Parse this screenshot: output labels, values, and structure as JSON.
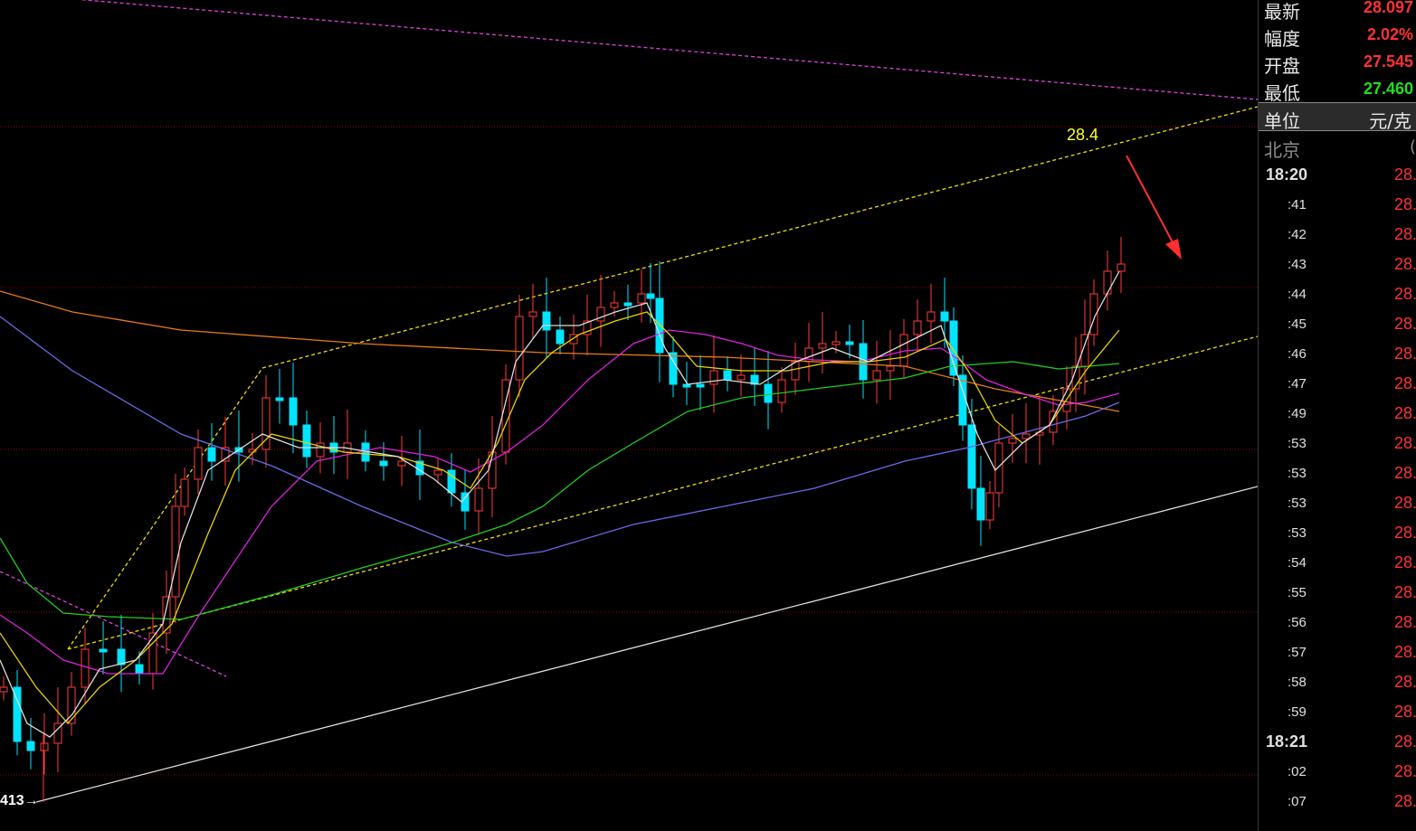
{
  "quote": {
    "rows": [
      {
        "label": "最新",
        "value": "28.097",
        "color": "#ff3333"
      },
      {
        "label": "幅度",
        "value": "2.02%",
        "color": "#ff3333"
      },
      {
        "label": "开盘",
        "value": "27.545",
        "color": "#ff3333"
      },
      {
        "label": "最低",
        "value": "27.460",
        "color": "#22dd22"
      }
    ],
    "unit_label": "单位",
    "unit_value": "元/克",
    "city": "北京",
    "city_extra": "("
  },
  "ticks": [
    {
      "time": "18:20",
      "price": "28.",
      "minute": true
    },
    {
      "time": ":41",
      "price": "28."
    },
    {
      "time": ":42",
      "price": "28."
    },
    {
      "time": ":43",
      "price": "28."
    },
    {
      "time": ":44",
      "price": "28."
    },
    {
      "time": ":45",
      "price": "28."
    },
    {
      "time": ":46",
      "price": "28."
    },
    {
      "time": ":47",
      "price": "28."
    },
    {
      "time": ":49",
      "price": "28."
    },
    {
      "time": ":53",
      "price": "28."
    },
    {
      "time": ":53",
      "price": "28."
    },
    {
      "time": ":53",
      "price": "28."
    },
    {
      "time": ":53",
      "price": "28."
    },
    {
      "time": ":54",
      "price": "28."
    },
    {
      "time": ":55",
      "price": "28."
    },
    {
      "time": ":56",
      "price": "28."
    },
    {
      "time": ":57",
      "price": "28."
    },
    {
      "time": ":58",
      "price": "28."
    },
    {
      "time": ":59",
      "price": "28."
    },
    {
      "time": "18:21",
      "price": "28.",
      "minute": true
    },
    {
      "time": ":02",
      "price": "28."
    },
    {
      "time": ":07",
      "price": "28."
    }
  ],
  "chart": {
    "annotation": "28.4",
    "low_marker": "413",
    "colors": {
      "up": "#ff3c3c",
      "down": "#00e5ff",
      "ma5": "#dddddd",
      "ma10": "#e8d200",
      "ma20": "#dd22dd",
      "ma60": "#22cc22",
      "ma120": "#6a6ae8",
      "ma250": "#e87a1a",
      "trend_yellow": "#f0e000",
      "trend_magenta": "#e040e0",
      "gridline": "#8b0000",
      "arrow": "#ff3030"
    }
  }
}
